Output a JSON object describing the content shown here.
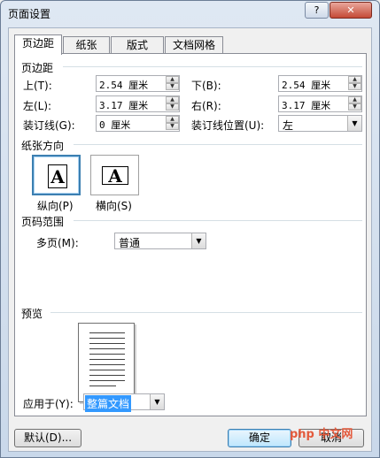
{
  "window": {
    "title": "页面设置",
    "help_icon": "?",
    "close_icon": "✕"
  },
  "tabs": [
    {
      "label": "页边距",
      "active": true
    },
    {
      "label": "纸张",
      "active": false
    },
    {
      "label": "版式",
      "active": false
    },
    {
      "label": "文档网格",
      "active": false
    }
  ],
  "margins": {
    "section": "页边距",
    "top": {
      "label": "上(T):",
      "value": "2.54 厘米"
    },
    "bottom": {
      "label": "下(B):",
      "value": "2.54 厘米"
    },
    "left": {
      "label": "左(L):",
      "value": "3.17 厘米"
    },
    "right": {
      "label": "右(R):",
      "value": "3.17 厘米"
    },
    "gutter": {
      "label": "装订线(G):",
      "value": "0 厘米"
    },
    "gutter_pos": {
      "label": "装订线位置(U):",
      "value": "左"
    }
  },
  "orientation": {
    "section": "纸张方向",
    "portrait_label": "纵向(P)",
    "landscape_label": "横向(S)",
    "glyph": "A",
    "selected": "portrait"
  },
  "pages": {
    "section": "页码范围",
    "multiple_label": "多页(M):",
    "multiple_value": "普通"
  },
  "preview": {
    "section": "预览"
  },
  "apply": {
    "label": "应用于(Y):",
    "value": "整篇文档"
  },
  "buttons": {
    "default": "默认(D)...",
    "ok": "确定",
    "cancel": "取消"
  },
  "watermark": "php 中文网"
}
